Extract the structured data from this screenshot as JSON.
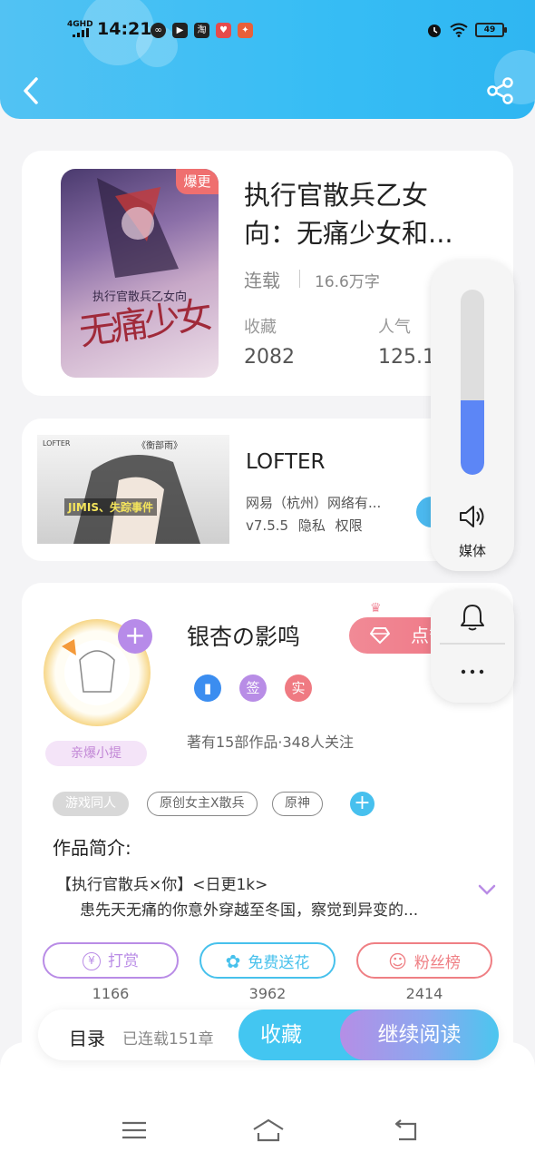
{
  "status_bar": {
    "network": "4GHD",
    "time": "14:21",
    "app_icons": [
      "weibo-icon",
      "player-icon",
      "taobao-icon",
      "heart-app-icon",
      "game-app-icon"
    ],
    "battery": "49"
  },
  "header": {
    "back_icon": "chevron-left-icon",
    "share_icon": "share-icon"
  },
  "book": {
    "cover_tag": "爆更",
    "cover_text": "执行官散兵乙女向",
    "cover_big": "无痛少女",
    "title": "执行官散兵乙女向：无痛少女和...",
    "status": "连载",
    "words": "16.6万字",
    "favorites_label": "收藏",
    "favorites_value": "2082",
    "popularity_label": "人气",
    "popularity_value": "125.1"
  },
  "ad": {
    "brand": "LOFTER",
    "brand2": "《衡部雨》",
    "caption": "JIMIS、失踪事件",
    "title": "LOFTER",
    "publisher": "网易（杭州）网络有...",
    "version": "v7.5.5",
    "privacy": "隐私",
    "permissions": "权限"
  },
  "author": {
    "name": "银杏の影鸣",
    "badge": "亲爆小提",
    "follow_label": "点赞",
    "badges": [
      {
        "text": "",
        "color": "#3b8df0"
      },
      {
        "text": "签",
        "color": "#b88de6"
      },
      {
        "text": "实",
        "color": "#ef7a82"
      }
    ],
    "meta": "著有15部作品·348人关注",
    "tags": [
      "游戏同人",
      "原创女主X散兵",
      "原神"
    ],
    "intro_heading": "作品简介:",
    "intro_line1": "【执行官散兵×你】<日更1k>",
    "intro_line2": "患先天无痛的你意外穿越至冬国，察觉到异变的...",
    "actions": [
      {
        "label": "打赏",
        "icon": "¥",
        "count": "1166",
        "color": "#b98ce6"
      },
      {
        "label": "免费送花",
        "icon": "✿",
        "count": "3962",
        "color": "#47c1ec"
      },
      {
        "label": "粉丝榜",
        "icon": "☺",
        "count": "2414",
        "color": "#ef7f84"
      }
    ]
  },
  "bottom_bar": {
    "toc": "目录",
    "chapters": "已连载151章",
    "collect": "收藏",
    "read": "继续阅读"
  },
  "nav": {
    "icons": [
      "menu-icon",
      "home-icon",
      "back-icon"
    ]
  },
  "volume": {
    "level": 0.4,
    "label": "媒体"
  },
  "colors": {
    "header": "#37bdf4",
    "accent": "#5c86f6"
  }
}
